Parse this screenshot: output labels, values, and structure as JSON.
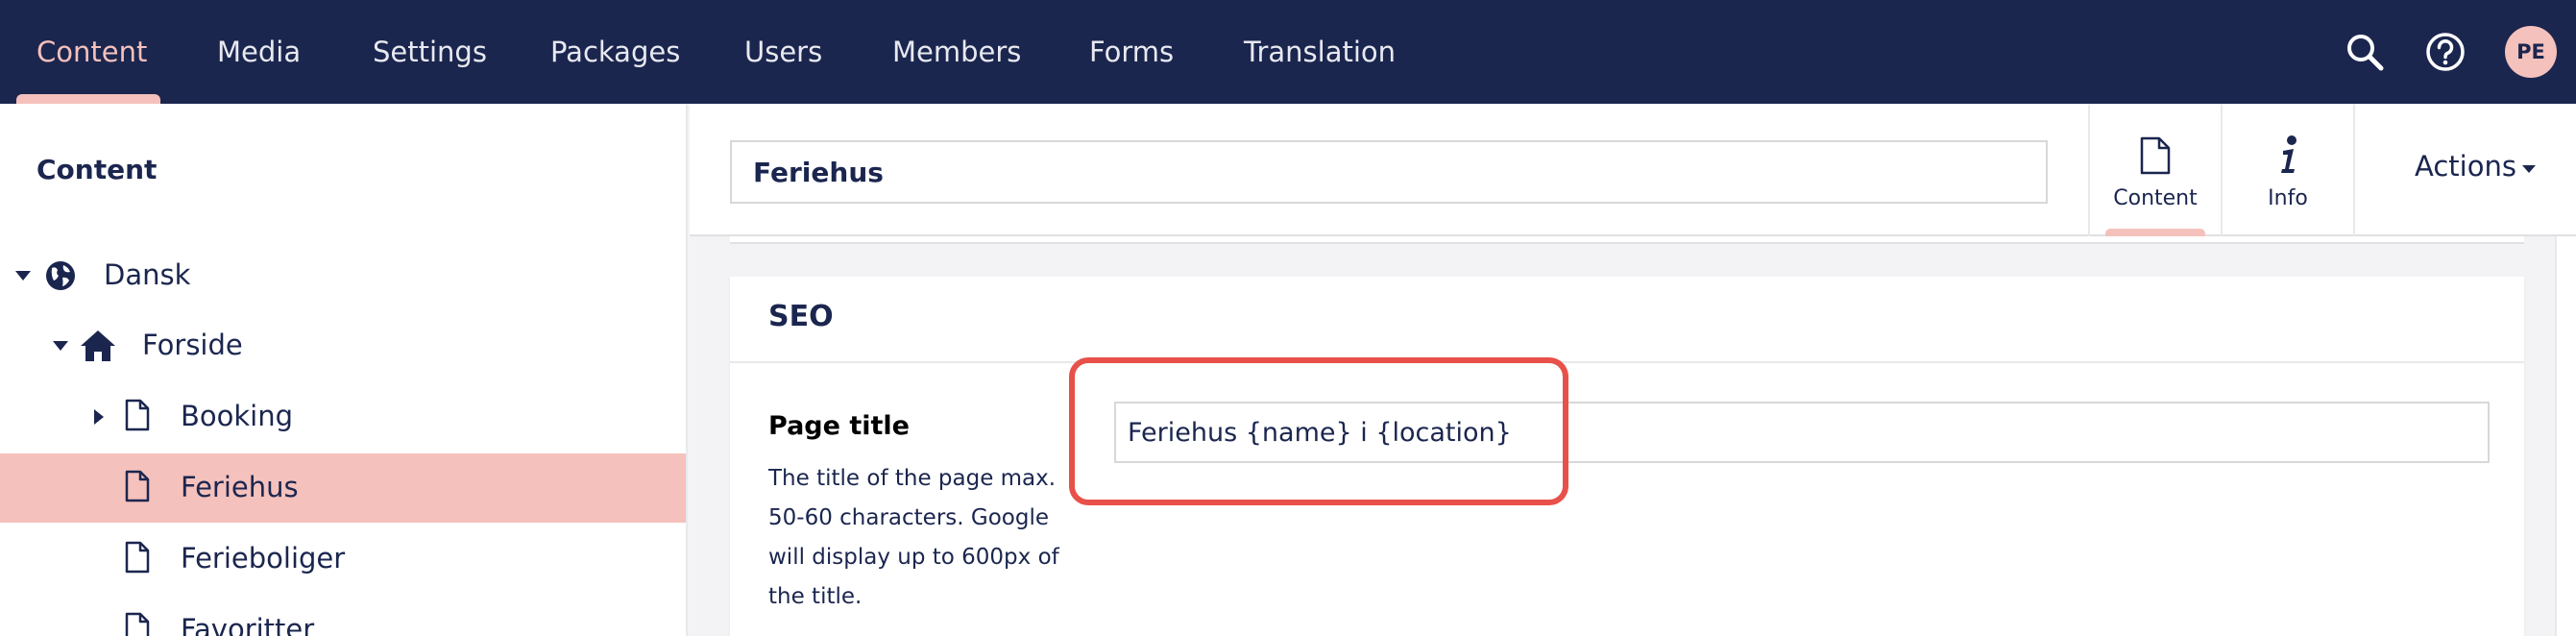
{
  "nav": {
    "items": [
      "Content",
      "Media",
      "Settings",
      "Packages",
      "Users",
      "Members",
      "Forms",
      "Translation"
    ],
    "active": "Content",
    "icons": [
      "search-icon",
      "help-icon"
    ],
    "avatar_initials": "PE"
  },
  "sidebar": {
    "title": "Content",
    "tree": [
      {
        "label": "Dansk",
        "icon": "globe-icon",
        "expanded": true
      },
      {
        "label": "Forside",
        "icon": "home-icon",
        "expanded": true
      },
      {
        "label": "Booking",
        "icon": "document-icon",
        "expanded": false
      },
      {
        "label": "Feriehus",
        "icon": "document-icon",
        "selected": true
      },
      {
        "label": "Ferieboliger",
        "icon": "document-icon"
      },
      {
        "label": "Favoritter",
        "icon": "document-icon"
      }
    ]
  },
  "editor": {
    "node_name": "Feriehus",
    "apps": [
      {
        "label": "Content",
        "icon": "document-icon",
        "active": true
      },
      {
        "label": "Info",
        "icon": "info-icon"
      }
    ],
    "actions_label": "Actions"
  },
  "panel": {
    "title": "SEO",
    "property": {
      "label": "Page title",
      "description": "The title of the page max. 50-60 characters. Google will display up to 600px of the title.",
      "value": "Feriehus {name} i {location}"
    }
  },
  "colors": {
    "nav_bg": "#1b264f",
    "accent": "#f5c1bc",
    "highlight": "#e8514a"
  }
}
